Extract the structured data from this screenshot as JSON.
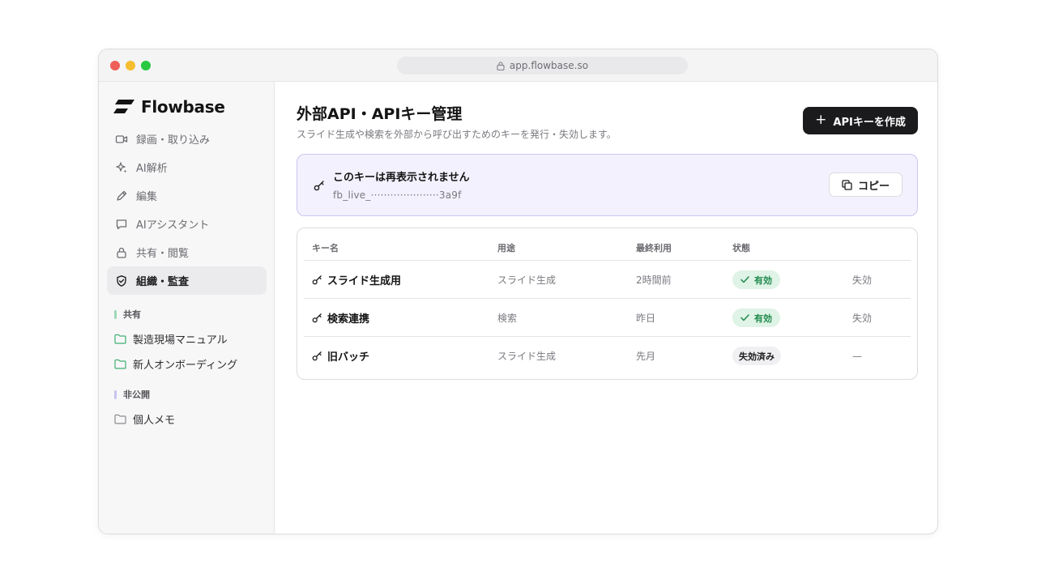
{
  "browser": {
    "url": "app.flowbase.so"
  },
  "brand": {
    "name": "Flowbase"
  },
  "sidebar": {
    "items": [
      {
        "label": "録画・取り込み",
        "icon": "video-icon"
      },
      {
        "label": "AI解析",
        "icon": "sparkle-icon"
      },
      {
        "label": "編集",
        "icon": "pencil-icon"
      },
      {
        "label": "AIアシスタント",
        "icon": "chat-icon"
      },
      {
        "label": "共有・閲覧",
        "icon": "lock-icon"
      },
      {
        "label": "組織・監査",
        "icon": "shield-check-icon",
        "active": true
      }
    ],
    "shared": {
      "label": "共有",
      "accent": "#9ed9b8",
      "folders": [
        "製造現場マニュアル",
        "新人オンボーディング"
      ]
    },
    "private": {
      "label": "非公開",
      "accent": "#c7c3f0",
      "folders": [
        "個人メモ"
      ]
    }
  },
  "main": {
    "title": "外部API・APIキー管理",
    "subtitle": "スライド生成や検索を外部から呼び出すためのキーを発行・失効します。",
    "create_button": "APIキーを作成",
    "notice": {
      "title": "このキーは再表示されません",
      "key": "fb_live_·····················3a9f",
      "copy_button": "コピー"
    },
    "table": {
      "headers": [
        "キー名",
        "用途",
        "最終利用",
        "状態"
      ],
      "rows": [
        {
          "name": "スライド生成用",
          "usage": "スライド生成",
          "last_used": "2時間前",
          "status": "有効",
          "status_type": "ok",
          "action": "失効"
        },
        {
          "name": "検索連携",
          "usage": "検索",
          "last_used": "昨日",
          "status": "有効",
          "status_type": "ok",
          "action": "失効"
        },
        {
          "name": "旧バッチ",
          "usage": "スライド生成",
          "last_used": "先月",
          "status": "失効済み",
          "status_type": "off",
          "action": "—"
        }
      ]
    }
  },
  "colors": {
    "accent_dark": "#1b1b1d",
    "ok_green": "#1f8a4c",
    "notice_bg": "#f2f1fd"
  }
}
